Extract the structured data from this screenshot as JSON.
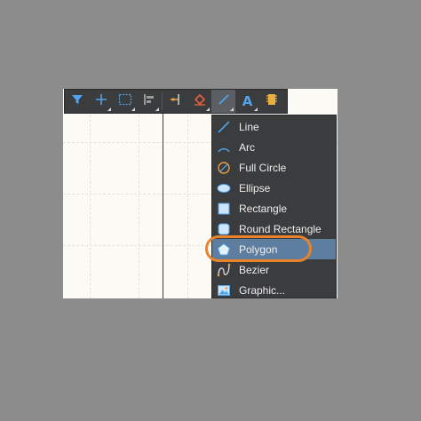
{
  "colors": {
    "backdrop": "#8c8c8c",
    "canvas": "#fbfaf5",
    "toolbar": "#3b3c3e",
    "menu_highlight": "#5e7e9f",
    "callout_ring": "#e8822b",
    "icon_blue": "#4fa3e8"
  },
  "toolbar": {
    "buttons": [
      {
        "name": "filter-icon",
        "has_dropdown": false
      },
      {
        "name": "crosshair-move-icon",
        "has_dropdown": true
      },
      {
        "name": "selection-rect-icon",
        "has_dropdown": true
      },
      {
        "name": "align-icon",
        "has_dropdown": true
      },
      {
        "name": "pin-icon",
        "has_dropdown": false
      },
      {
        "name": "eraser-icon",
        "has_dropdown": true
      },
      {
        "name": "line-draw-icon",
        "has_dropdown": true,
        "active": true
      },
      {
        "name": "text-icon",
        "has_dropdown": true
      },
      {
        "name": "component-icon",
        "has_dropdown": false
      }
    ],
    "text_button_glyph": "A"
  },
  "menu": {
    "items": [
      {
        "label": "Line",
        "icon": "line-icon"
      },
      {
        "label": "Arc",
        "icon": "arc-icon"
      },
      {
        "label": "Full Circle",
        "icon": "full-circle-icon"
      },
      {
        "label": "Ellipse",
        "icon": "ellipse-icon"
      },
      {
        "label": "Rectangle",
        "icon": "rectangle-icon"
      },
      {
        "label": "Round Rectangle",
        "icon": "round-rectangle-icon"
      },
      {
        "label": "Polygon",
        "icon": "polygon-icon",
        "highlighted": true
      },
      {
        "label": "Bezier",
        "icon": "bezier-icon"
      },
      {
        "label": "Graphic...",
        "icon": "graphic-icon"
      }
    ]
  }
}
